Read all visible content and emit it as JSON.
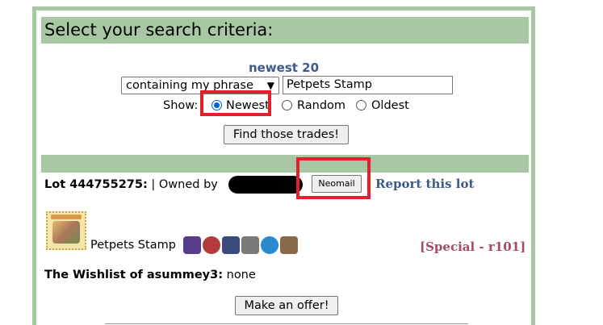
{
  "header": {
    "title": "Select your search criteria:"
  },
  "search": {
    "subtitle": "newest 20",
    "filter_selected": "containing my phrase",
    "phrase_value": "Petpets Stamp",
    "show_label": "Show:",
    "options": [
      {
        "label": "Newest",
        "checked": true
      },
      {
        "label": "Random",
        "checked": false
      },
      {
        "label": "Oldest",
        "checked": false
      }
    ],
    "find_button": "Find those trades!"
  },
  "lot": {
    "title": "Lot 444755275:",
    "owned_by": "| Owned by",
    "neomail_button": "Neomail",
    "separator": "|",
    "report_link": "Report this lot",
    "item_name": "Petpets Stamp",
    "special": "[Special - r101]",
    "wishlist_label": "The Wishlist of asummey3:",
    "wishlist_value": "none",
    "offer_button": "Make an offer!"
  },
  "colors": {
    "header_bg": "#a7c8a3",
    "link": "#3e5a8a",
    "special": "#a54a6a",
    "highlight": "#e0202a"
  }
}
